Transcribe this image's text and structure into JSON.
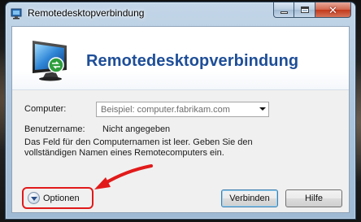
{
  "window": {
    "title": "Remotedesktopverbindung",
    "caption_close_glyph": "✕"
  },
  "header": {
    "heading": "Remotedesktopverbindung"
  },
  "form": {
    "computer_label": "Computer:",
    "computer_placeholder": "Beispiel: computer.fabrikam.com",
    "username_label": "Benutzername:",
    "username_value": "Nicht angegeben",
    "info_text": "Das Feld für den Computernamen ist leer. Geben Sie den vollständigen Namen eines Remotecomputers ein."
  },
  "footer": {
    "options_label": "Optionen",
    "connect_label": "Verbinden",
    "help_label": "Hilfe"
  },
  "icons": {
    "app": "remote-desktop-icon",
    "monitor": "monitor-icon",
    "options": "chevron-down-circle-icon"
  },
  "colors": {
    "heading": "#1e4e98",
    "annotation": "#e11a1a",
    "close_button": "#c2391a"
  }
}
